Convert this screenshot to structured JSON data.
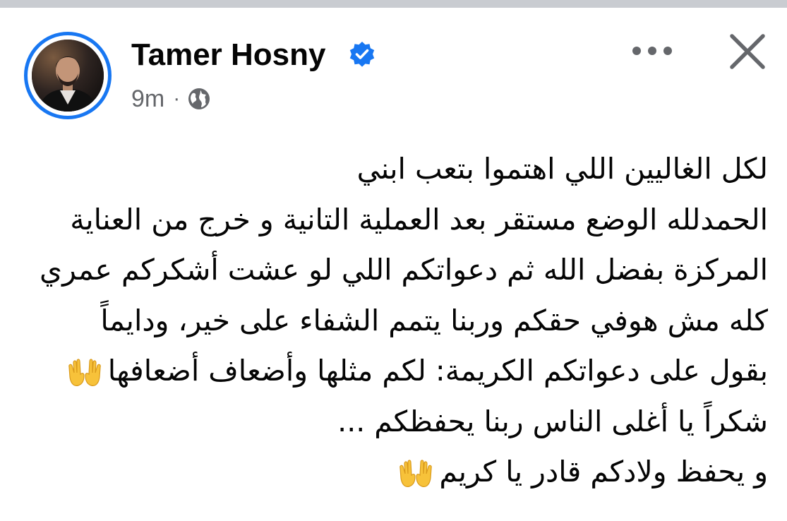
{
  "post": {
    "author_name": "Tamer Hosny",
    "verified_icon": "verified-badge-icon",
    "timestamp": "9m",
    "separator": "·",
    "audience_icon": "globe-icon",
    "text_lines": [
      "لكل الغاليين اللي اهتموا بتعب ابني",
      "الحمدلله الوضع مستقر بعد العملية التانية و خرج من العناية",
      "المركزة بفضل الله ثم دعواتكم اللي لو عشت أشكركم عمري",
      "كله مش هوفي حقكم وربنا يتمم الشفاء على خير، ودايماً",
      "بقول على دعواتكم الكريمة: لكم مثلها وأضعاف أضعافها",
      "شكراً يا أغلى الناس ربنا يحفظكم ...",
      "و يحفظ ولادكم قادر يا كريم"
    ],
    "emoji_icon": "palms-up-together-icon"
  },
  "header": {
    "more_icon": "more-options-icon",
    "close_icon": "close-icon"
  },
  "colors": {
    "accent": "#1877f2",
    "secondary_text": "#65676b",
    "primary_text": "#050505",
    "top_strip": "#c9ccd1",
    "emoji": "#f7c23a"
  }
}
